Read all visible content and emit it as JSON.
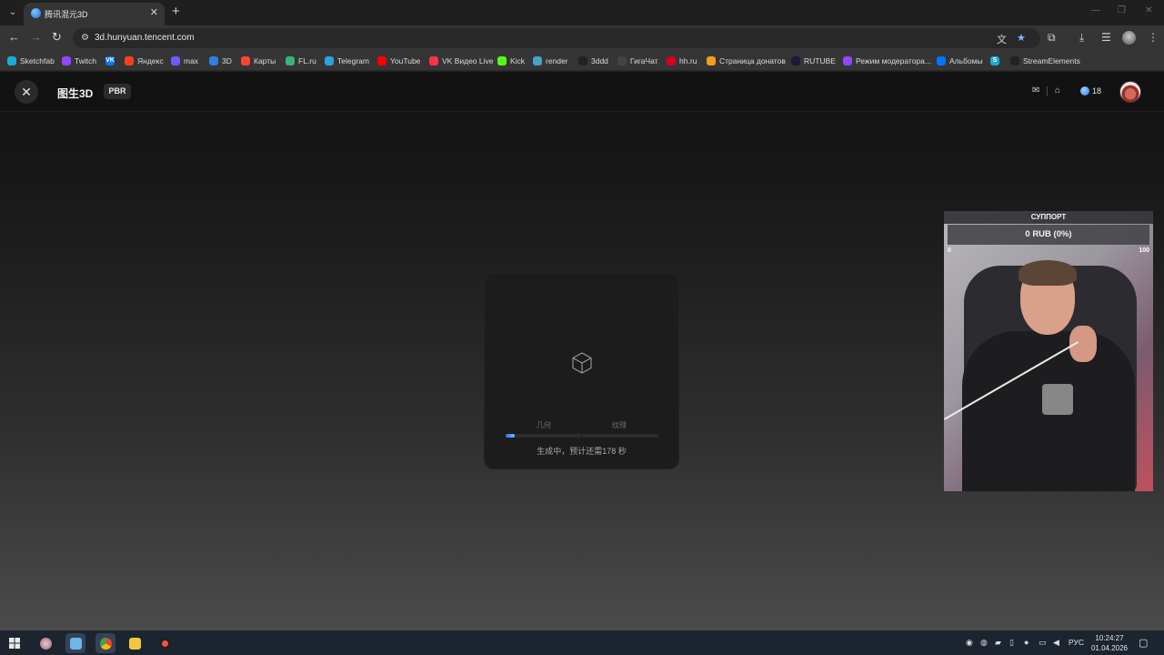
{
  "browser": {
    "tab": {
      "title": "腾讯混元3D"
    },
    "url": "3d.hunyuan.tencent.com",
    "bookmarks": [
      {
        "label": "Sketchfab",
        "color": "#1caad9"
      },
      {
        "label": "Twitch",
        "color": "#9146ff"
      },
      {
        "label": "",
        "color": "#0077ff",
        "icon_text": "VK"
      },
      {
        "label": "Яндекс",
        "color": "#fc3f1d"
      },
      {
        "label": "max",
        "color": "#6a5cff"
      },
      {
        "label": "3D",
        "color": "#2f7fe0"
      },
      {
        "label": "Карты",
        "color": "#ff4433"
      },
      {
        "label": "FL.ru",
        "color": "#36b37e"
      },
      {
        "label": "Telegram",
        "color": "#2aa3e0"
      },
      {
        "label": "YouTube",
        "color": "#ff0000"
      },
      {
        "label": "VK Видео Live",
        "color": "#ff3347"
      },
      {
        "label": "Kick",
        "color": "#53fc18"
      },
      {
        "label": "render",
        "color": "#46a3c8"
      },
      {
        "label": "3ddd",
        "color": "#222222"
      },
      {
        "label": "ГигаЧат",
        "color": "#444444"
      },
      {
        "label": "hh.ru",
        "color": "#d6001c"
      },
      {
        "label": "Страница донатов",
        "color": "#f59c1a"
      },
      {
        "label": "RUTUBE",
        "color": "#1a1a3a"
      },
      {
        "label": "Режим модератора...",
        "color": "#9146ff"
      },
      {
        "label": "Альбомы",
        "color": "#0077ff"
      },
      {
        "label": "",
        "color": "#1caad9",
        "icon_text": "S"
      },
      {
        "label": "StreamElements",
        "color": "#222222"
      }
    ]
  },
  "app": {
    "title": "图生3D",
    "badge": "PBR",
    "credits": "18"
  },
  "progress": {
    "steps": [
      "几何",
      "纹理"
    ],
    "percent": 6,
    "status": "生成中，预计还需178 秒"
  },
  "overlay": {
    "header": "СУППОРТ",
    "amount": "0 RUB (0%)",
    "min": "0",
    "max": "100"
  },
  "taskbar": {
    "lang": "РУС",
    "time": "10:24:27",
    "date": "01.04.2026"
  }
}
